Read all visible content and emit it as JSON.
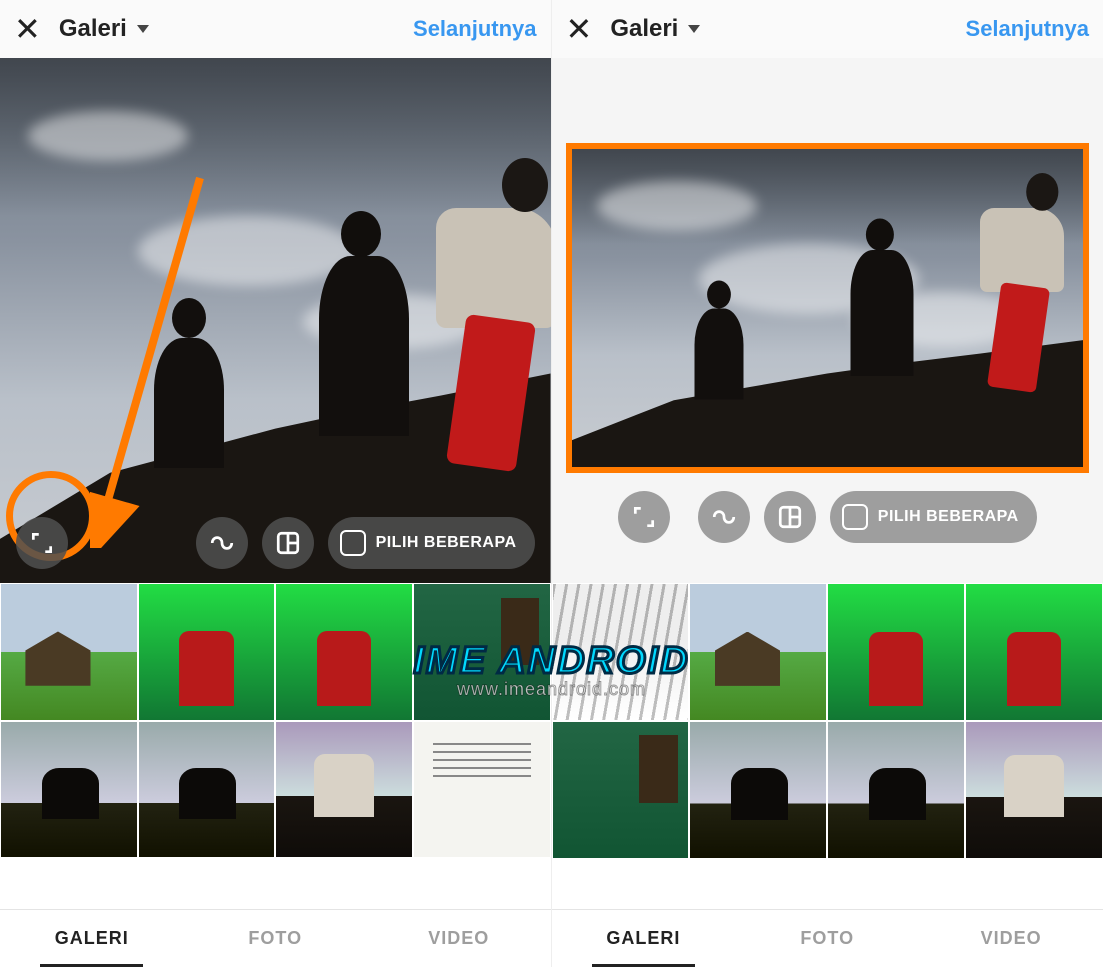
{
  "header": {
    "title": "Galeri",
    "next": "Selanjutnya"
  },
  "buttons": {
    "select_multiple": "PILIH BEBERAPA"
  },
  "tabs": {
    "gallery": "GALERI",
    "photo": "FOTO",
    "video": "VIDEO"
  },
  "annotation": {
    "highlight_color": "#ff7a00"
  },
  "watermark": {
    "brand": "IME ANDROID",
    "url": "www.imeandroid.com"
  }
}
